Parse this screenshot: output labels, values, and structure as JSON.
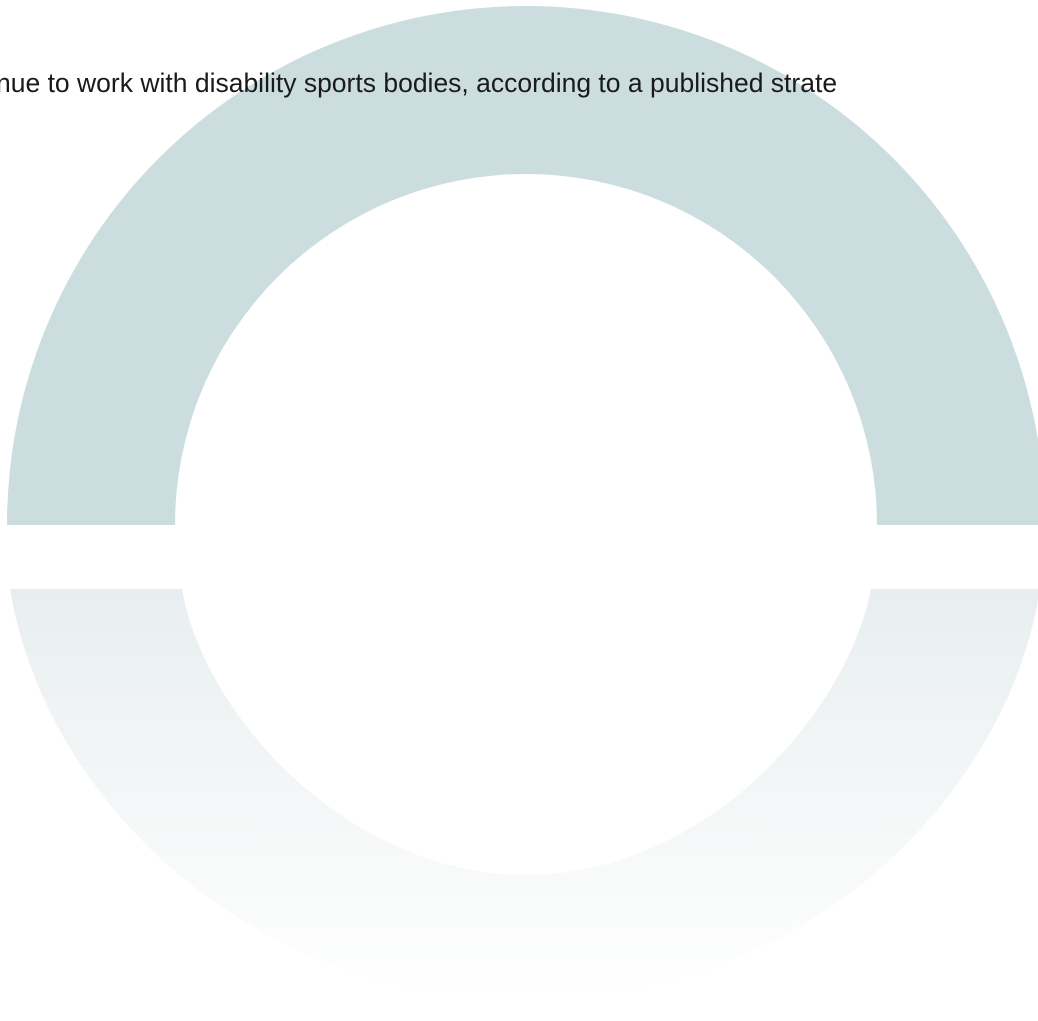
{
  "caption": {
    "text": "ntinue to work with disability sports bodies, according to a published strate"
  },
  "graphic": {
    "icon": "split-ring-icon",
    "upper_color": "#cbdddf",
    "lower_color_top": "#e8eeef",
    "lower_color_bottom": "#ffffff"
  }
}
